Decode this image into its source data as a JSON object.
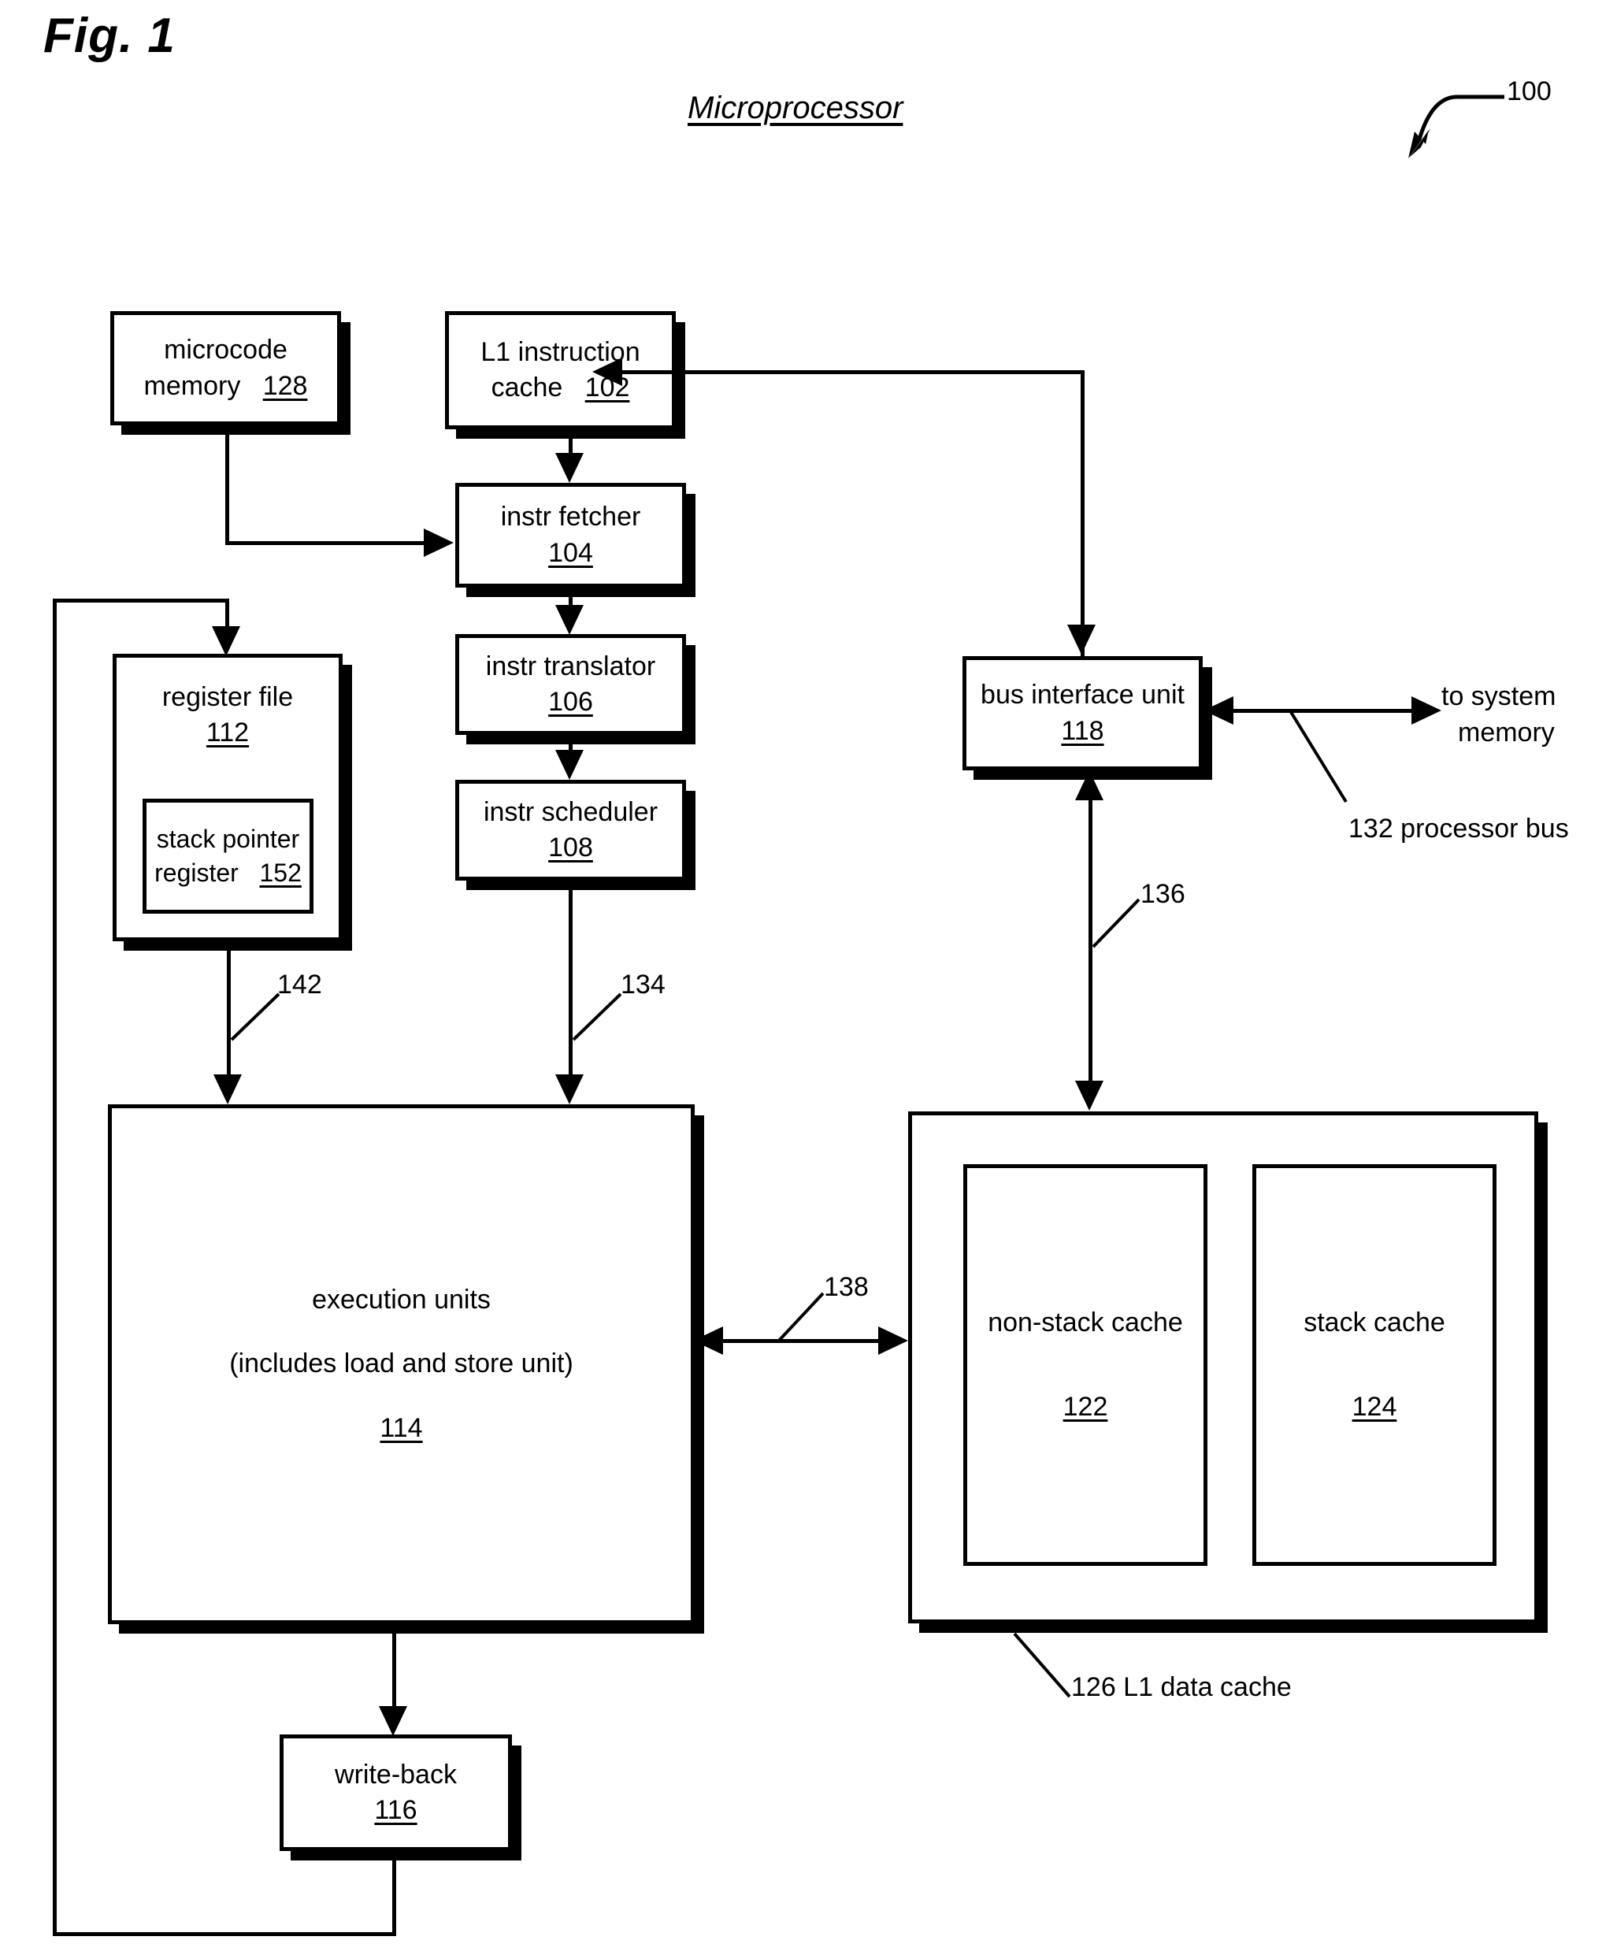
{
  "figure": {
    "label": "Fig. 1",
    "title": "Microprocessor",
    "top_ref": "100"
  },
  "blocks": {
    "microcode_memory": {
      "line1": "microcode",
      "line2": "memory",
      "ref": "128"
    },
    "l1_instruction_cache": {
      "line1": "L1 instruction",
      "line2": "cache",
      "ref": "102"
    },
    "instr_fetcher": {
      "line1": "instr fetcher",
      "ref": "104"
    },
    "instr_translator": {
      "line1": "instr translator",
      "ref": "106"
    },
    "instr_scheduler": {
      "line1": "instr scheduler",
      "ref": "108"
    },
    "register_file": {
      "line1": "register file",
      "ref": "112"
    },
    "stack_pointer_register": {
      "line1": "stack pointer",
      "line2": "register",
      "ref": "152"
    },
    "execution_units": {
      "line1": "execution units",
      "line2": "(includes load and store unit)",
      "ref": "114"
    },
    "write_back": {
      "line1": "write-back",
      "ref": "116"
    },
    "bus_interface_unit": {
      "line1": "bus interface unit",
      "ref": "118"
    },
    "non_stack_cache": {
      "line1": "non-stack cache",
      "ref": "122"
    },
    "stack_cache": {
      "line1": "stack cache",
      "ref": "124"
    },
    "l1_data_cache": {
      "caption": "126  L1 data cache"
    }
  },
  "annotations": {
    "to_system_memory_l1": "to system",
    "to_system_memory_l2": "memory",
    "processor_bus": "132 processor bus",
    "signal_142": "142",
    "signal_134": "134",
    "signal_136": "136",
    "signal_138": "138"
  }
}
